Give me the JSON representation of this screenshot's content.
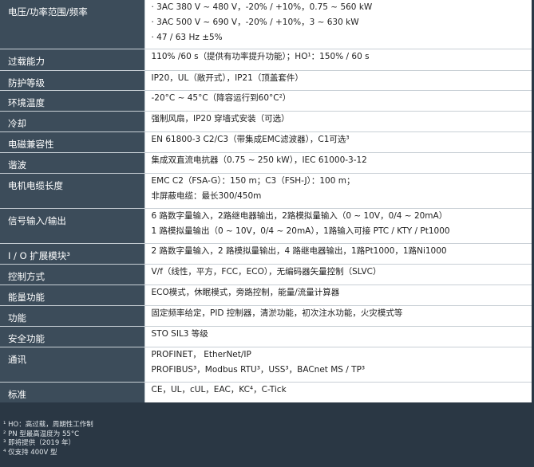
{
  "rows": [
    {
      "label": "电压/功率范围/频率",
      "lines": [
        "· 3AC 380 V ~ 480 V，-20% / +10%，0.75 ~ 560 kW",
        "· 3AC 500 V ~ 690 V，-20% / +10%，3 ~ 630 kW",
        "· 47 / 63 Hz  ±5%"
      ]
    },
    {
      "label": "过载能力",
      "lines": [
        "110% /60 s（提供有功率提升功能）；HO¹：150% / 60 s"
      ]
    },
    {
      "label": "防护等级",
      "lines": [
        "IP20，UL（敞开式），IP21（顶盖套件）"
      ]
    },
    {
      "label": "环境温度",
      "lines": [
        "-20°C ~ 45°C（降容运行到60°C²）"
      ]
    },
    {
      "label": "冷却",
      "lines": [
        "强制风扇，IP20 穿墙式安装（可选）"
      ]
    },
    {
      "label": "电磁兼容性",
      "lines": [
        "EN 61800-3 C2/C3（带集成EMC滤波器），C1可选³"
      ]
    },
    {
      "label": "谐波",
      "lines": [
        "集成双直流电抗器（0.75 ~ 250 kW），IEC 61000-3-12"
      ]
    },
    {
      "label": "电机电缆长度",
      "lines": [
        "EMC C2（FSA-G）：150 m；C3（FSH-J）：100 m；",
        "非屏蔽电缆：最长300/450m"
      ]
    },
    {
      "label": "信号输入/输出",
      "lines": [
        "6 路数字量输入，2路继电器输出，2路模拟量输入（0 ~ 10V，0/4 ~ 20mA）",
        "1 路模拟量输出（0 ~ 10V，0/4 ~ 20mA），1路输入可接 PTC / KTY / Pt1000"
      ]
    },
    {
      "label": "I / O 扩展模块³",
      "lines": [
        "2 路数字量输入，2 路模拟量输出，4 路继电器输出，1路Pt1000，1路Ni1000"
      ]
    },
    {
      "label": "控制方式",
      "lines": [
        "V/f（线性，平方，FCC，ECO），无编码器矢量控制（SLVC）"
      ]
    },
    {
      "label": "能量功能",
      "lines": [
        "ECO模式，休眠模式，旁路控制，能量/流量计算器"
      ]
    },
    {
      "label": "功能",
      "lines": [
        "固定频率给定，PID 控制器，清淤功能，初次注水功能，火灾模式等"
      ]
    },
    {
      "label": "安全功能",
      "lines": [
        "STO SIL3 等级"
      ]
    },
    {
      "label": "通讯",
      "lines": [
        "PROFINET， EtherNet/IP",
        "PROFIBUS³，Modbus RTU³，USS³，BACnet MS / TP³"
      ]
    },
    {
      "label": "标准",
      "lines": [
        "CE，UL，cUL，EAC，KC⁴，C-Tick"
      ]
    }
  ],
  "footnotes": [
    "¹ HO：高过载，周期性工作制",
    "² PN 型最高温度为 55°C",
    "³ 即将提供（2019 年）",
    "⁴ 仅支持 400V 型"
  ]
}
